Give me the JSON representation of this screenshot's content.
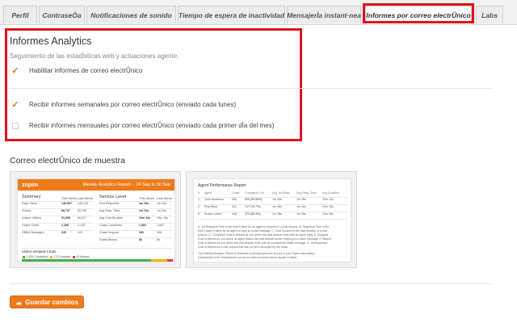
{
  "tabs": [
    {
      "label": "Perfil"
    },
    {
      "label": "ContraseÒa"
    },
    {
      "label": "Notificaciones de sonido"
    },
    {
      "label": "Tiempo de espera de inactividad"
    },
    {
      "label": "MensajerÌa instant·nea"
    },
    {
      "label": "Informes por correo electrÛnico"
    },
    {
      "label": "Labs"
    }
  ],
  "analytics": {
    "title": "Informes Analytics",
    "subtitle": "Seguimiento de las estadÌsticas web y actuaciones agente.",
    "enable_label": "Habilitar informes de correo electrÛnico",
    "weekly_label": "Recibir informes semanales por correo electrÛnico (enviado cada lunes)",
    "monthly_label": "Recibir informes mensuales por correo electrÛnico (enviado cada primer dÌa del mes)",
    "enable_checked": true,
    "weekly_checked": true,
    "monthly_checked": false
  },
  "sample": {
    "title": "Correo electrÛnico de muestra",
    "left": {
      "logo": "zopim",
      "report_title": "Weekly Analytics Report -- 24 Sep to 30 Sep",
      "summary_heading": "Summary",
      "summary_cols": [
        "This Week",
        "Last Week"
      ],
      "summary_rows": [
        [
          "Page Views",
          "140,537",
          "143,103"
        ],
        [
          "Visitors",
          "88,767",
          "89,783"
        ],
        [
          "Unique Visitors",
          "51,958",
          "50,917"
        ],
        [
          "Online Chats",
          "2,408",
          "2,130"
        ],
        [
          "Offline Messages",
          "235",
          "223"
        ]
      ],
      "service_heading": "Service Level",
      "service_cols": [
        "This Week",
        "Last Week"
      ],
      "service_rows": [
        [
          "First Response",
          "1m 26s",
          "1m 19s"
        ],
        [
          "Avg Resp. Time",
          "1m 24s",
          "1m 22s"
        ],
        [
          "Avg Chat Duration",
          "10m 43s",
          "10m 18s"
        ],
        [
          "Chats Completed",
          "1,960",
          "1,682"
        ],
        [
          "Chats Dropped",
          "336",
          "356"
        ],
        [
          "Chats Missed",
          "80",
          "60"
        ]
      ],
      "visitor_heading": "Visitor-initiated Chats",
      "legend": [
        {
          "label": "1,428 Completed",
          "color": "#4caf50"
        },
        {
          "label": "174 Dropped",
          "color": "#f5b400"
        },
        {
          "label": "45 Missed",
          "color": "#e53935"
        }
      ],
      "bar_fractions": [
        0.86,
        0.105,
        0.035
      ]
    },
    "right": {
      "heading": "Agent Performance Report",
      "cols": [
        "#",
        "Agent",
        "Chats",
        "Completed (%)",
        "Avg 1st Resp.",
        "Avg Resp. Time",
        "Avg Duration"
      ],
      "rows": [
        [
          "1",
          "John Anderson",
          "600",
          "600 (93.98%)",
          "1m 28s",
          "1m 28s",
          "10m 14s"
        ],
        [
          "2",
          "Roy Mikal",
          "911",
          "717 (78.7%)",
          "1m 36s",
          "1m 42s",
          "10m 43s"
        ],
        [
          "3",
          "Susan Lentle",
          "448",
          "373 (83.3%)",
          "1m 28s",
          "1m 39s",
          "10m 55s"
        ]
      ],
      "notes": [
        "A. 1st Response Time is the time it takes for an agent to respond to a chat request. B. Response Time is the",
        "time it takes it takes for an agent to reply to a chat message. C. Chat Duration is the total duration of a chat",
        "session. D. Completed Chat is defined as one where the chat session ends with an agent reply. E. Dropped",
        "Chat is defined as one where an agent leaves the chat session before replying to a visitor message. F. Missed",
        "Chat is defined as one where the chat session ends with an unanswered visitor message. G. Unresponsive",
        "Chat is defined as a chat request that has not been accepted by the visitor."
      ],
      "footer": [
        "This Weekly Analytics Report is delivered to john@zopim.com as part of your Zopim subscription.",
        "Unsubscribe in the Dashboard if you do not wish to receive these reports in future."
      ]
    }
  },
  "save_button": {
    "label": "Guardar cambios"
  },
  "colors": {
    "accent": "#ee7a1c",
    "highlight": "#e0101c"
  }
}
